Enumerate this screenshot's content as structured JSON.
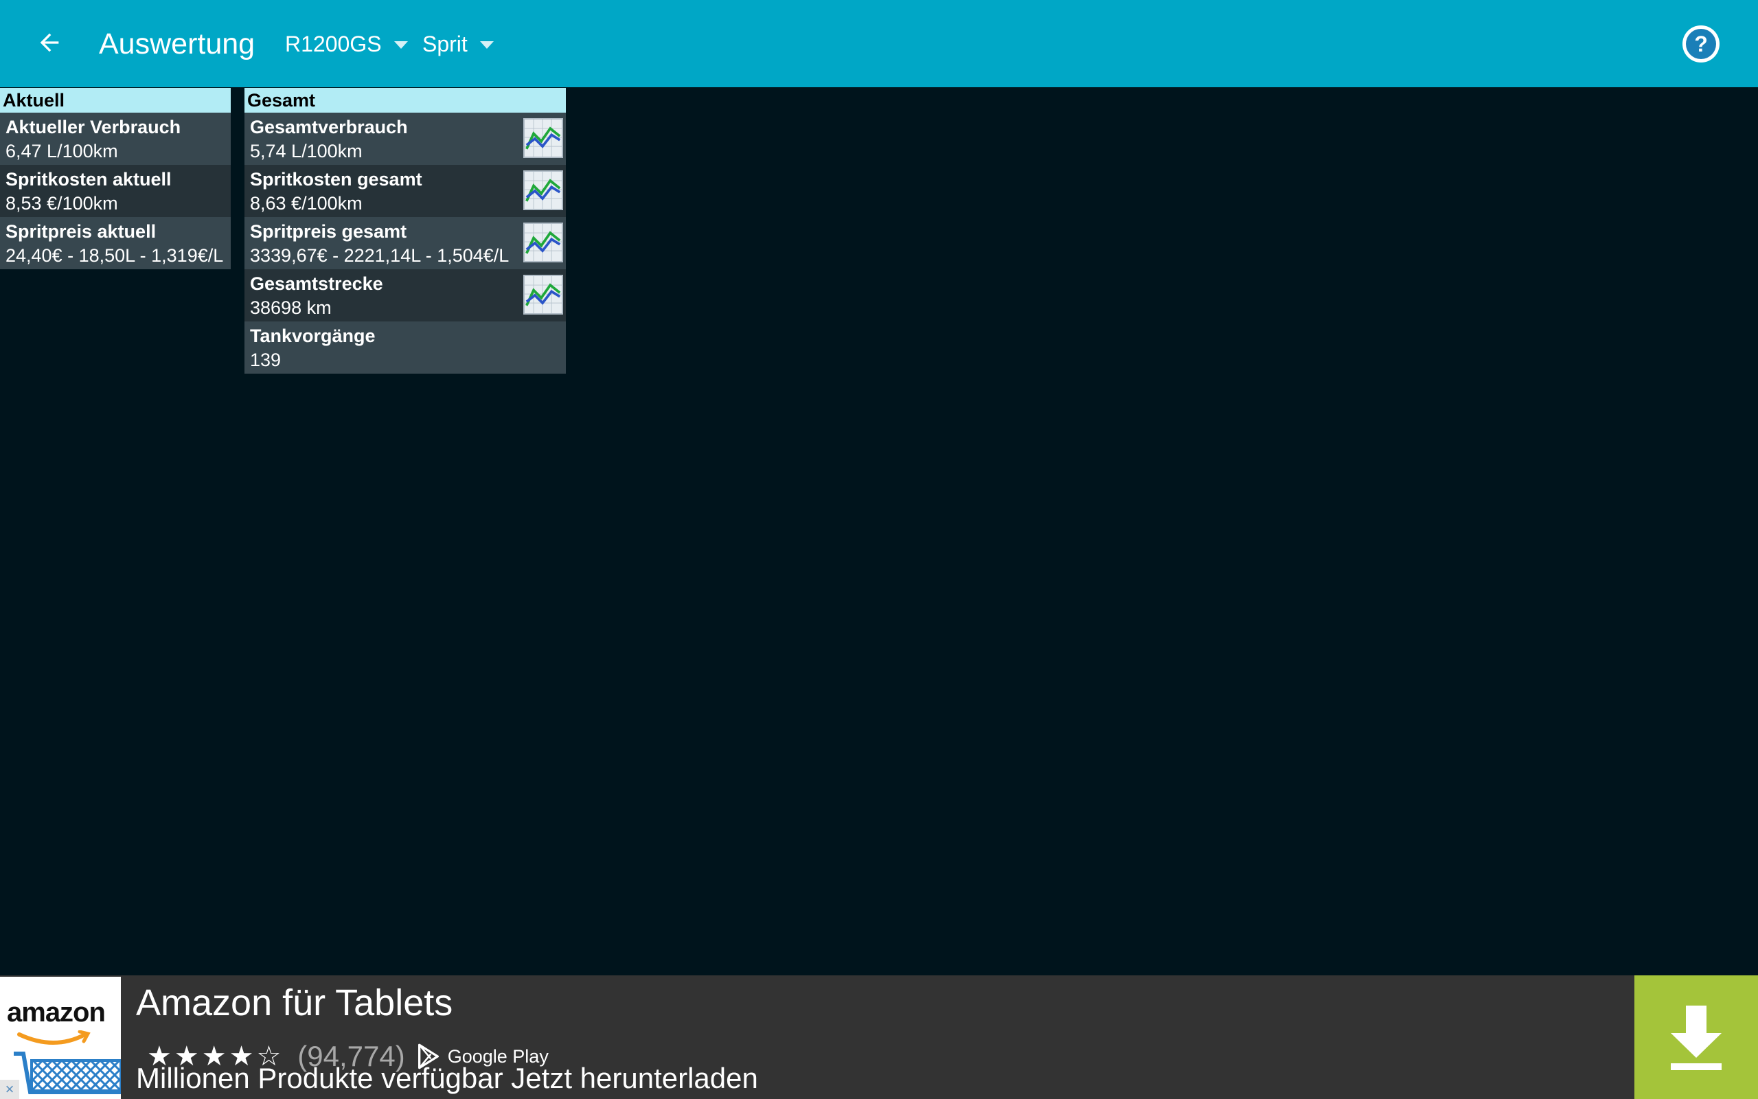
{
  "appbar": {
    "title": "Auswertung",
    "vehicle": "R1200GS",
    "type": "Sprit",
    "back_icon": "arrow-left-icon",
    "help_icon": "question-mark-icon",
    "help_glyph": "?",
    "color": "#00a7c6"
  },
  "current": {
    "header": "Aktuell",
    "items": [
      {
        "label": "Aktueller Verbrauch",
        "value": "6,47 L/100km"
      },
      {
        "label": "Spritkosten aktuell",
        "value": "8,53 €/100km"
      },
      {
        "label": "Spritpreis aktuell",
        "value": "24,40€ - 18,50L - 1,319€/L"
      }
    ]
  },
  "total": {
    "header": "Gesamt",
    "items": [
      {
        "label": "Gesamtverbrauch",
        "value": "5,74 L/100km",
        "graph": true
      },
      {
        "label": "Spritkosten gesamt",
        "value": "8,63 €/100km",
        "graph": true
      },
      {
        "label": "Spritpreis gesamt",
        "value": "3339,67€ - 2221,14L - 1,504€/L",
        "graph": true
      },
      {
        "label": "Gesamtstrecke",
        "value": "38698 km",
        "graph": true
      },
      {
        "label": "Tankvorgänge",
        "value": "139",
        "graph": false
      }
    ]
  },
  "ad": {
    "logo_text": "amazon",
    "title": "Amazon für Tablets",
    "stars": "★★★★☆",
    "rating_count": "(94,774)",
    "store": "Google Play",
    "subtitle": "Millionen Produkte verfügbar Jetzt herunterladen",
    "close_glyph": "×",
    "download_icon": "download-arrow-icon",
    "download_color": "#a4c43a"
  }
}
